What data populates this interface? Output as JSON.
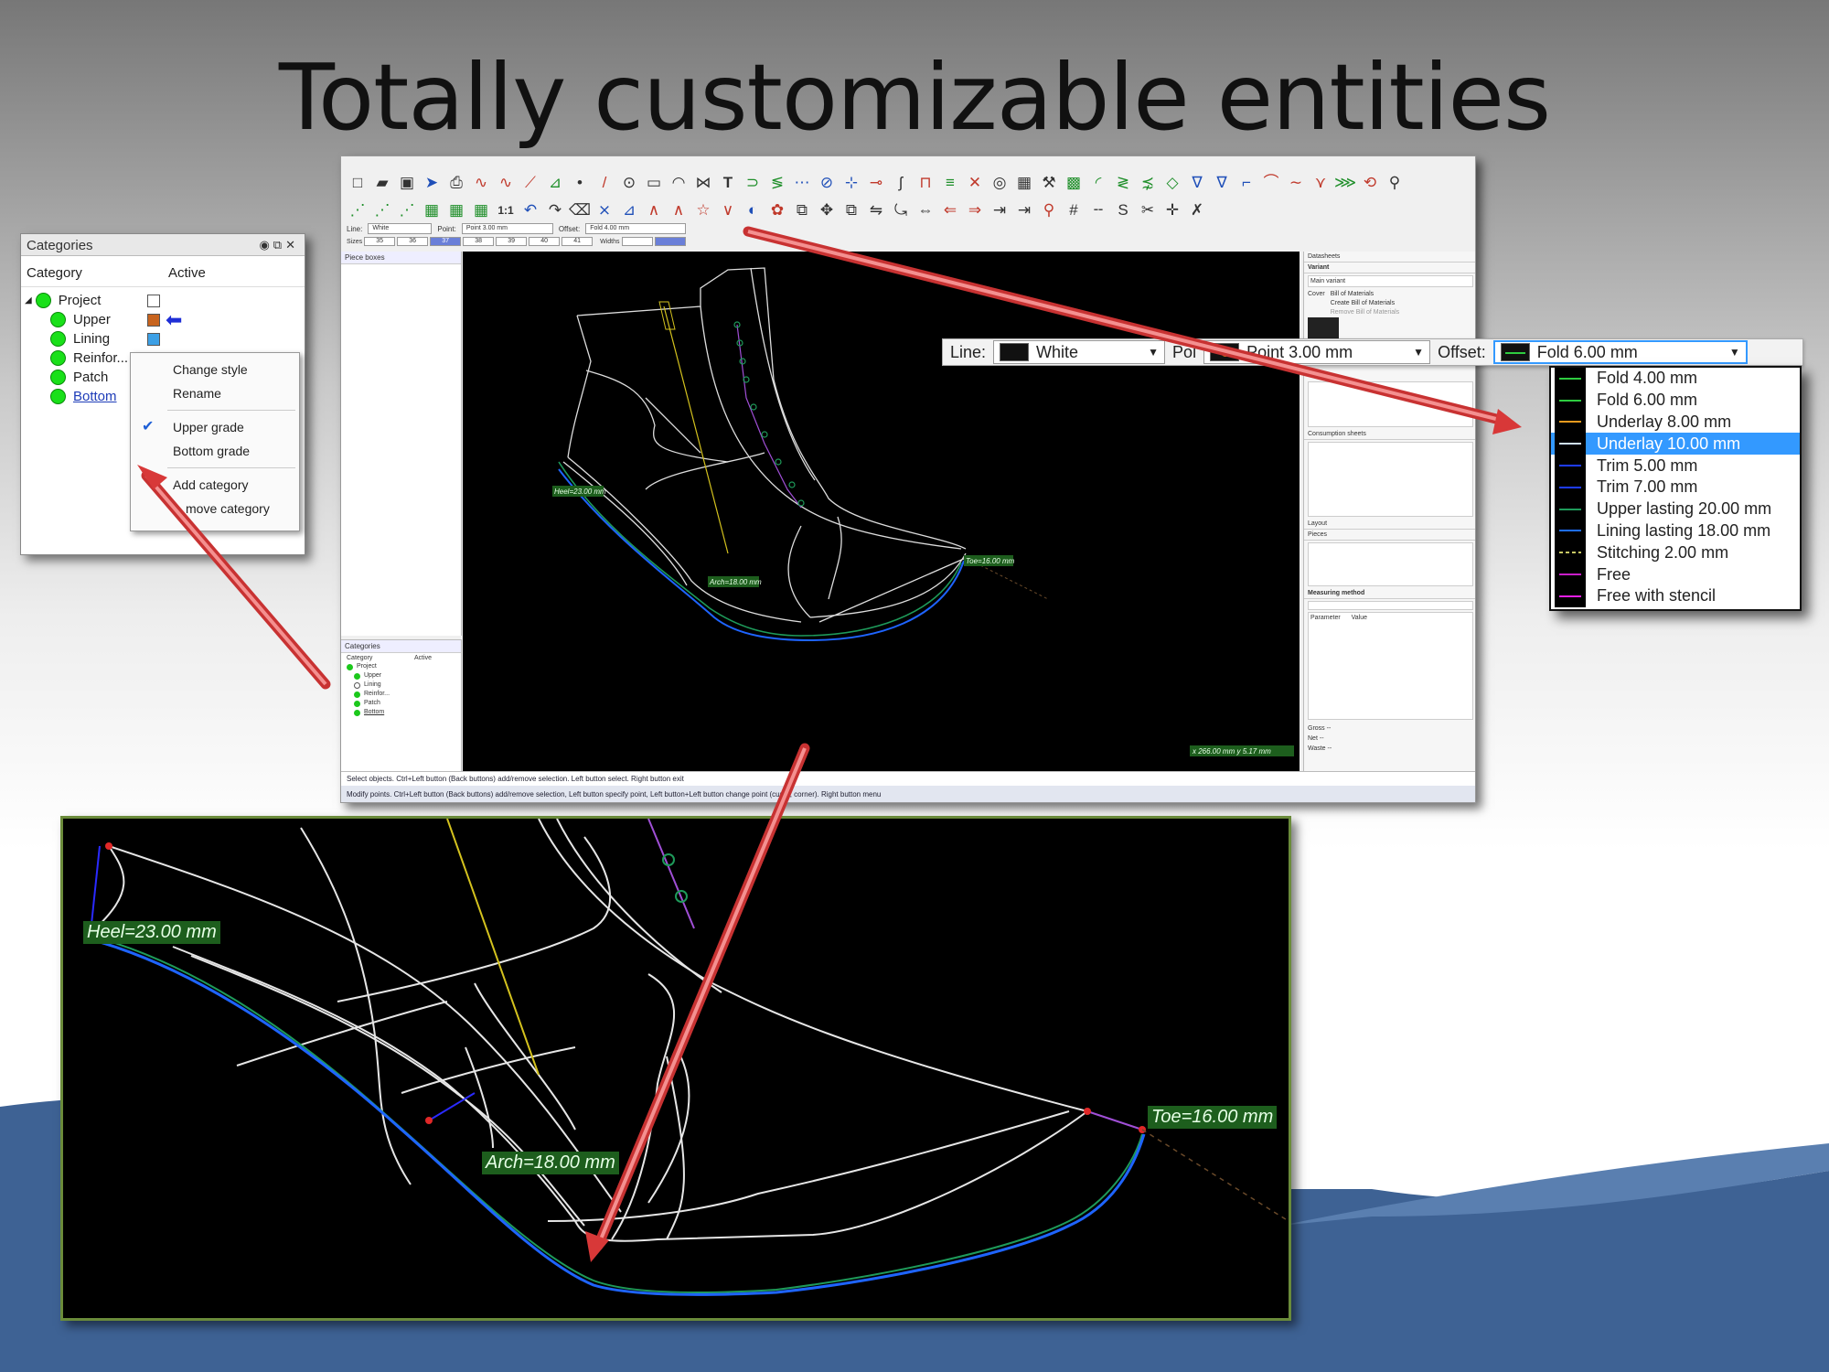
{
  "slide": {
    "title": "Totally customizable entities"
  },
  "app": {
    "line_label": "Line:",
    "line_value": "White",
    "point_label": "Point:",
    "point_value": "Point 3.00 mm",
    "offset_label": "Offset:",
    "offset_value": "Fold 4.00 mm",
    "sizes_label": "Sizes",
    "sizes": [
      "35",
      "36",
      "37",
      "38",
      "39",
      "40",
      "41"
    ],
    "selected_size": "37",
    "widths_label": "Widths",
    "piece_boxes_title": "Piece boxes",
    "canvas_labels": {
      "heel": "Heel=23.00 mm",
      "arch": "Arch=18.00 mm",
      "toe": "Toe=16.00 mm"
    },
    "coordinates": "x 266.00 mm  y 5.17 mm",
    "right_panel": {
      "datasheets": "Datasheets",
      "variant": "Variant",
      "main_variant": "Main variant",
      "cover": "Cover",
      "bill_of_materials": "Bill of Materials",
      "create_bom": "Create Bill of Materials",
      "remove_bom": "Remove Bill of Materials",
      "consumption_sheets": "Consumption sheets",
      "layout": "Layout",
      "pieces": "Pieces",
      "measuring_method": "Measuring method",
      "parameter": "Parameter",
      "value": "Value",
      "gross": "Gross",
      "net": "Net",
      "waste": "Waste",
      "dash": "--"
    },
    "mini_categories": {
      "title": "Categories",
      "col_category": "Category",
      "col_active": "Active",
      "rows": [
        "Project",
        "Upper",
        "Lining",
        "Reinfor...",
        "Patch",
        "Bottom"
      ]
    },
    "status_line1": "Select objects. Ctrl+Left button (Back buttons) add/remove selection. Left button select. Right button exit",
    "status_line2": "Modify points. Ctrl+Left button (Back buttons) add/remove selection, Left button specify point, Left button+Left button change point (curve, corner). Right button menu"
  },
  "categories_panel": {
    "title": "Categories",
    "col_category": "Category",
    "col_active": "Active",
    "rows": [
      {
        "label": "Project",
        "swatch": "#ffffff"
      },
      {
        "label": "Upper",
        "swatch": "#c8641e"
      },
      {
        "label": "Lining",
        "swatch": "#3ca0e6"
      },
      {
        "label": "Reinfor...",
        "swatch": "#d4c21e"
      },
      {
        "label": "Patch",
        "swatch": ""
      },
      {
        "label": "Bottom",
        "swatch": ""
      }
    ],
    "context_menu": [
      "Change style",
      "Rename",
      "Upper grade",
      "Bottom grade",
      "Add category",
      "Remove category"
    ],
    "context_menu_visible": [
      "Change style",
      "Rename",
      "Upper grade",
      "Bottom grade",
      "Add category",
      "move category"
    ],
    "checked_item": "Upper grade"
  },
  "zoom_bar": {
    "line_label": "Line:",
    "line_value": "White",
    "point_label_partial": "Poi",
    "point_value": "Point 3.00 mm",
    "offset_label": "Offset:",
    "offset_value": "Fold 6.00 mm"
  },
  "offset_dropdown": {
    "items": [
      {
        "label": "Fold 4.00 mm",
        "color": "#2ecc40"
      },
      {
        "label": "Fold 6.00 mm",
        "color": "#2ecc40"
      },
      {
        "label": "Underlay 8.00 mm",
        "color": "#e69a1e"
      },
      {
        "label": "Underlay 10.00 mm",
        "color": "#cfe0ff"
      },
      {
        "label": "Trim 5.00 mm",
        "color": "#1e3cff"
      },
      {
        "label": "Trim 7.00 mm",
        "color": "#1e3cff"
      },
      {
        "label": "Upper lasting 20.00 mm",
        "color": "#1e9a5a"
      },
      {
        "label": "Lining lasting 18.00 mm",
        "color": "#1e6eff"
      },
      {
        "label": "Stitching 2.00 mm",
        "color": "#c8c864"
      },
      {
        "label": "Free",
        "color": "#c81ec8"
      },
      {
        "label": "Free with stencil",
        "color": "#e61ee6"
      }
    ],
    "selected": "Underlay 10.00 mm"
  },
  "zoom_view": {
    "heel": "Heel=23.00 mm",
    "arch": "Arch=18.00 mm",
    "toe": "Toe=16.00 mm"
  },
  "colors": {
    "accent_arrow": "#e05050",
    "canvas_bg": "#000000",
    "bottom_curve": "#1e64ff",
    "alt_curve": "#1e9a5a",
    "selection_blue": "#3399ff"
  }
}
